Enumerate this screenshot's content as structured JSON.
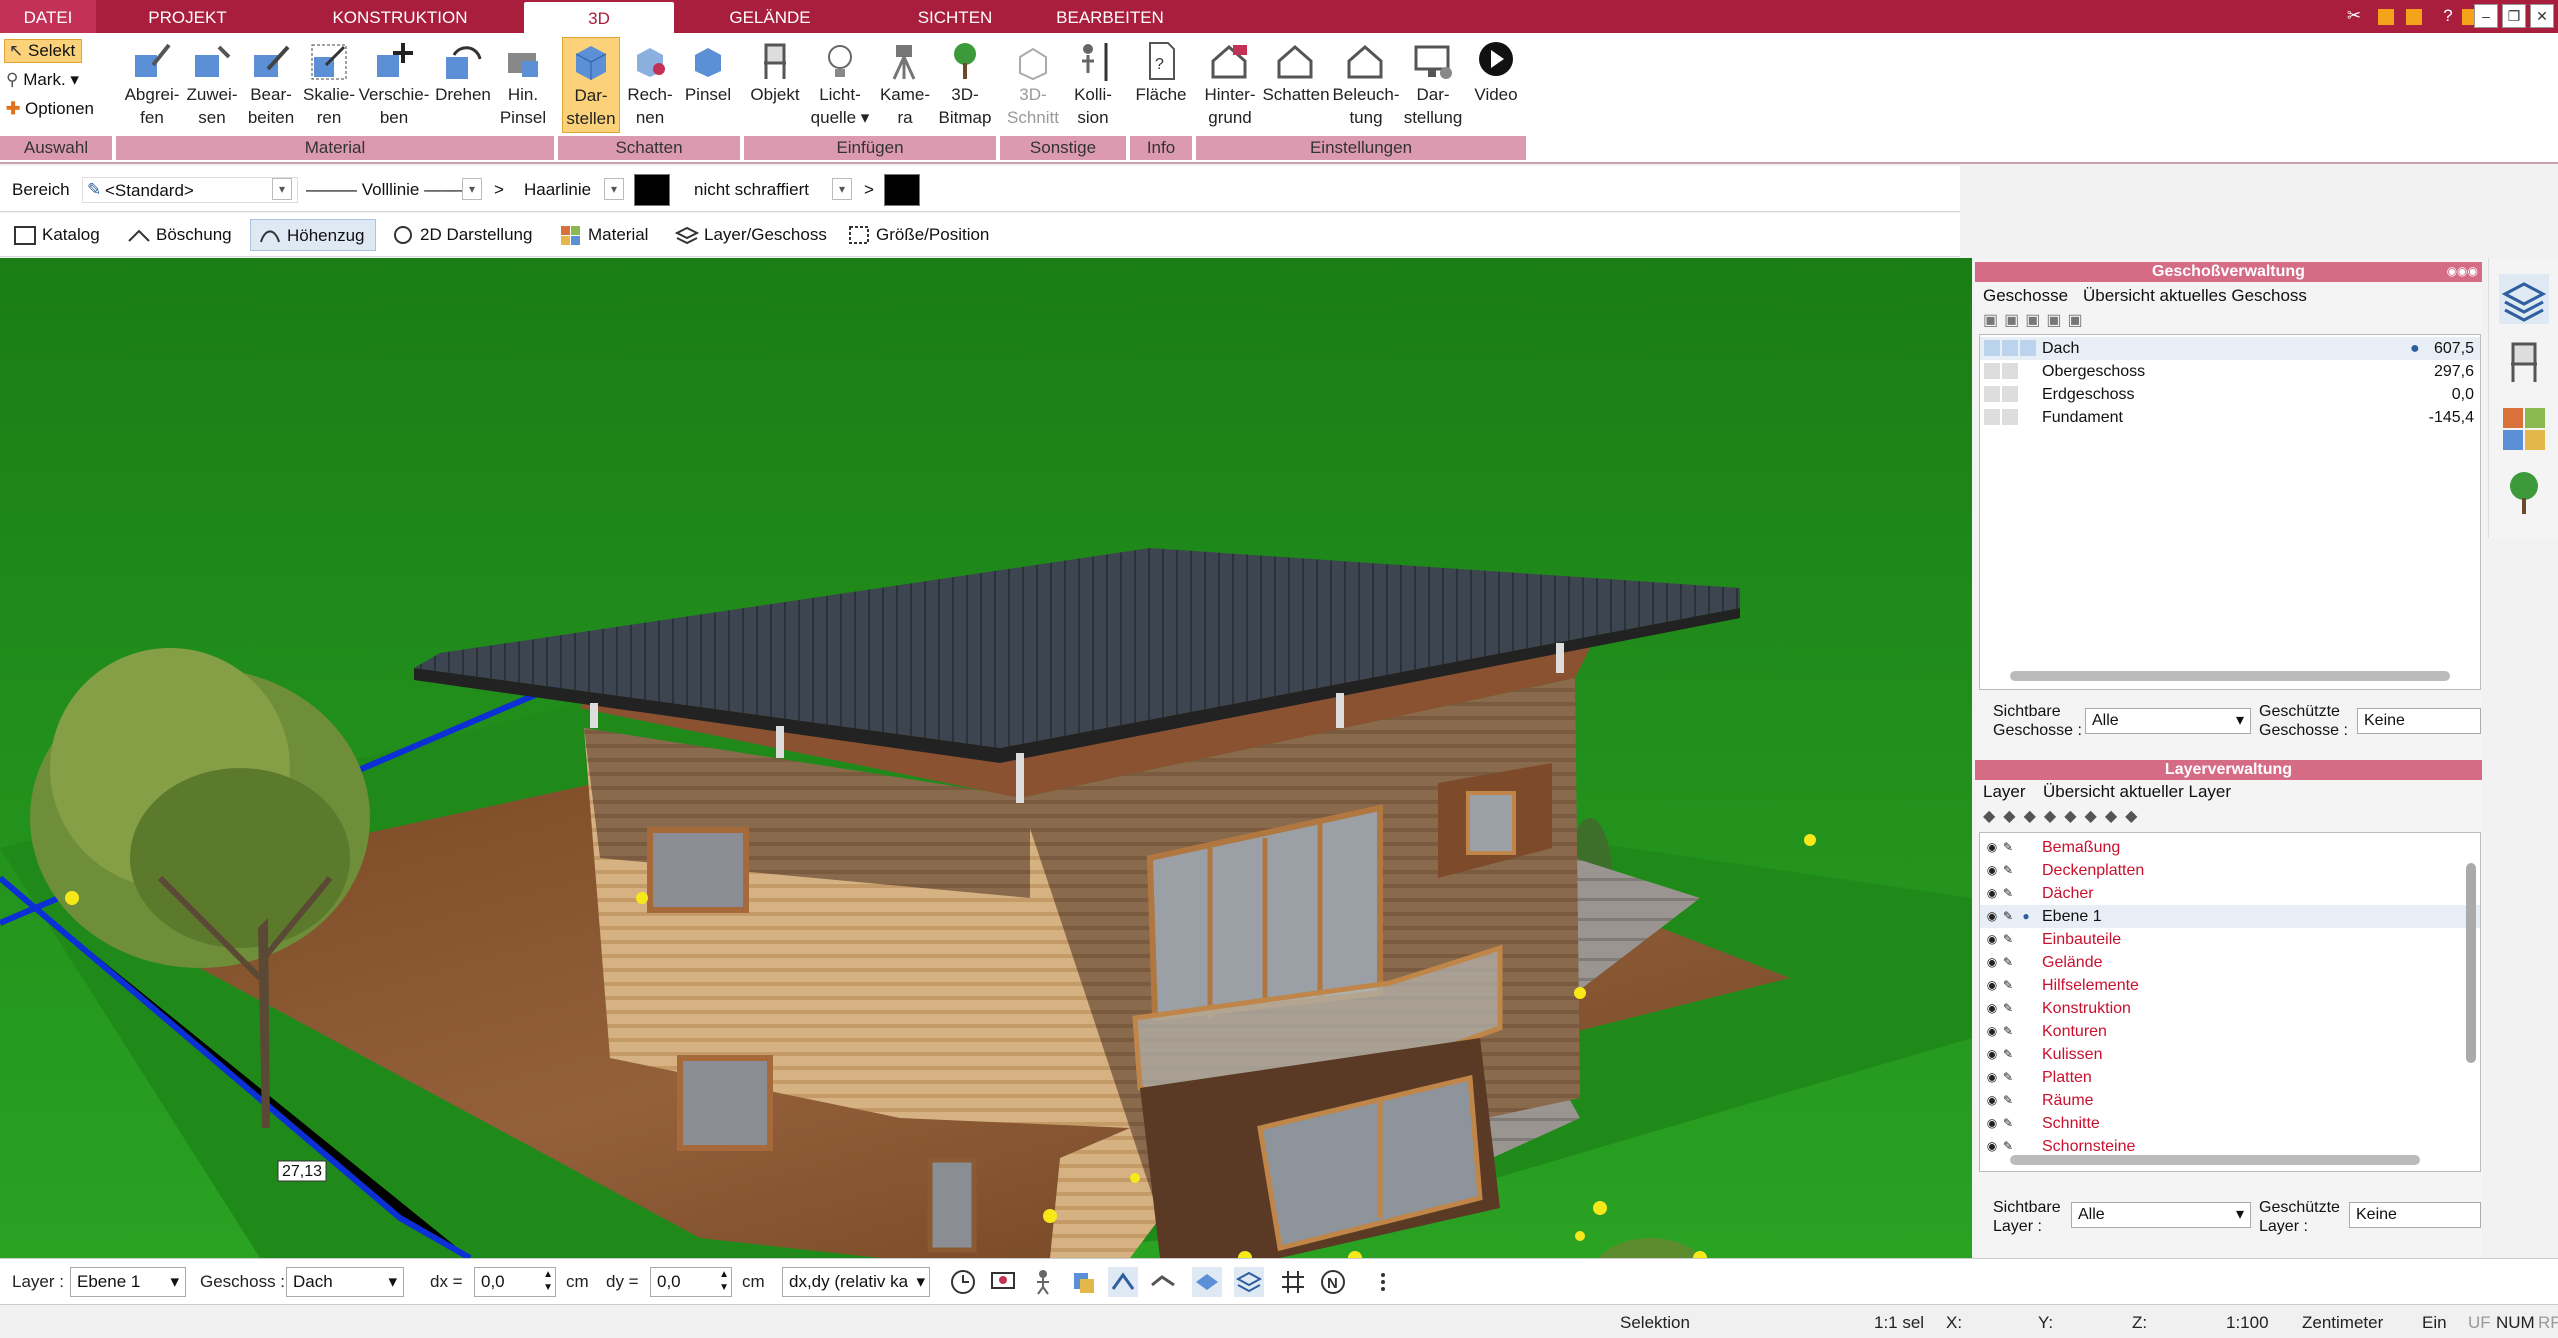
{
  "tabs": [
    "DATEI",
    "PROJEKT",
    "KONSTRUKTION",
    "3D",
    "GELÄNDE",
    "SICHTEN",
    "BEARBEITEN"
  ],
  "ribbon": {
    "auswahl": {
      "selekt": "Selekt",
      "mark": "Mark.",
      "optionen": "Optionen"
    },
    "material_buttons": [
      {
        "l1": "Abgrei-",
        "l2": "fen"
      },
      {
        "l1": "Zuwei-",
        "l2": "sen"
      },
      {
        "l1": "Bear-",
        "l2": "beiten"
      },
      {
        "l1": "Skalie-",
        "l2": "ren"
      },
      {
        "l1": "Verschie-",
        "l2": "ben"
      },
      {
        "l1": "Drehen",
        "l2": ""
      },
      {
        "l1": "Hin.",
        "l2": "Pinsel"
      }
    ],
    "schatten_buttons": [
      {
        "l1": "Dar-",
        "l2": "stellen"
      },
      {
        "l1": "Rech-",
        "l2": "nen"
      },
      {
        "l1": "Pinsel",
        "l2": ""
      }
    ],
    "einfuegen_buttons": [
      {
        "l1": "Objekt",
        "l2": ""
      },
      {
        "l1": "Licht-",
        "l2": "quelle"
      },
      {
        "l1": "Kame-",
        "l2": "ra"
      },
      {
        "l1": "3D-",
        "l2": "Bitmap"
      }
    ],
    "sonstige_buttons": [
      {
        "l1": "3D-",
        "l2": "Schnitt"
      },
      {
        "l1": "Kolli-",
        "l2": "sion"
      }
    ],
    "info_buttons": [
      {
        "l1": "Fläche",
        "l2": ""
      }
    ],
    "einst_buttons": [
      {
        "l1": "Hinter-",
        "l2": "grund"
      },
      {
        "l1": "Schatten",
        "l2": ""
      },
      {
        "l1": "Beleuch-",
        "l2": "tung"
      },
      {
        "l1": "Dar-",
        "l2": "stellung"
      },
      {
        "l1": "Video",
        "l2": ""
      }
    ],
    "groups": [
      "Auswahl",
      "Material",
      "Schatten",
      "Einfügen",
      "Sonstige",
      "Info",
      "Einstellungen"
    ]
  },
  "propbar": {
    "bereich": "Bereich",
    "standard": "<Standard>",
    "linie": "Volllinie",
    "haarlinie": "Haarlinie",
    "schraffur": "nicht schraffiert",
    "gt": ">"
  },
  "toolbar2": [
    "Katalog",
    "Böschung",
    "Höhenzug",
    "2D Darstellung",
    "Material",
    "Layer/Geschoss",
    "Größe/Position"
  ],
  "viewport": {
    "dimension_label": "27,13"
  },
  "geschoss": {
    "title": "Geschoßverwaltung",
    "tab1": "Geschosse",
    "tab2": "Übersicht aktuelles Geschoss",
    "rows": [
      {
        "name": "Dach",
        "value": "607,5"
      },
      {
        "name": "Obergeschoss",
        "value": "297,6"
      },
      {
        "name": "Erdgeschoss",
        "value": "0,0"
      },
      {
        "name": "Fundament",
        "value": "-145,4"
      }
    ],
    "sichtbare_label1": "Sichtbare",
    "sichtbare_label2": "Geschosse :",
    "sichtbare_value": "Alle",
    "geschuetzte_label1": "Geschützte",
    "geschuetzte_label2": "Geschosse :",
    "geschuetzte_value": "Keine"
  },
  "layer": {
    "title": "Layerverwaltung",
    "tab1": "Layer",
    "tab2": "Übersicht aktueller Layer",
    "rows": [
      "Bemaßung",
      "Deckenplatten",
      "Dächer",
      "Ebene 1",
      "Einbauteile",
      "Gelände",
      "Hilfselemente",
      "Konstruktion",
      "Konturen",
      "Kulissen",
      "Platten",
      "Räume",
      "Schnitte",
      "Schornsteine"
    ],
    "sichtbare_label1": "Sichtbare",
    "sichtbare_label2": "Layer :",
    "sichtbare_value": "Alle",
    "geschuetzte_label1": "Geschützte",
    "geschuetzte_label2": "Layer :",
    "geschuetzte_value": "Keine"
  },
  "bottombar": {
    "layer_label": "Layer :",
    "layer_value": "Ebene 1",
    "geschoss_label": "Geschoss :",
    "geschoss_value": "Dach",
    "dx_label": "dx =",
    "dx_value": "0,0",
    "dx_unit": "cm",
    "dy_label": "dy =",
    "dy_value": "0,0",
    "dy_unit": "cm",
    "mode": "dx,dy (relativ ka"
  },
  "statusbar": {
    "mode": "Selektion",
    "sel": "1:1 sel",
    "x": "X:",
    "y": "Y:",
    "z": "Z:",
    "scale": "1:100",
    "unit": "Zentimeter",
    "ein": "Ein",
    "uf": "UF",
    "num": "NUM",
    "rf": "RF"
  }
}
